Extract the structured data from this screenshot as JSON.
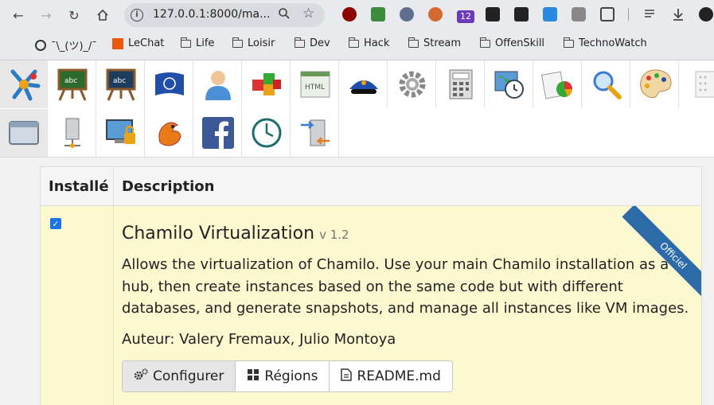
{
  "browser": {
    "url": "127.0.0.1:8000/ma...",
    "extension_badge": "12"
  },
  "bookmarks": [
    {
      "label": "¯\\_(ツ)_/¯",
      "icon": "openai-icon"
    },
    {
      "label": "LeChat",
      "icon": "lechat-icon"
    },
    {
      "label": "Life",
      "icon": "folder-icon"
    },
    {
      "label": "Loisir",
      "icon": "folder-icon"
    },
    {
      "label": "Dev",
      "icon": "folder-icon"
    },
    {
      "label": "Hack",
      "icon": "folder-icon"
    },
    {
      "label": "Stream",
      "icon": "folder-icon"
    },
    {
      "label": "OffenSkill",
      "icon": "folder-icon"
    },
    {
      "label": "TechnoWatch",
      "icon": "folder-icon"
    }
  ],
  "admin_icons": [
    "chamilo-logo-icon",
    "blackboard-easel-icon",
    "blackboard-easel-alt-icon",
    "un-flag-icon",
    "user-icon",
    "blocks-icon",
    "html-editor-icon",
    "police-cap-icon",
    "gear-icon",
    "calculator-icon",
    "world-clock-icon",
    "reports-icon",
    "magnifier-icon",
    "palette-icon",
    "dots-grid-icon",
    "window-icon",
    "server-icon",
    "monitor-lock-icon",
    "dragon-icon",
    "facebook-icon",
    "clock-icon",
    "server-transfer-icon"
  ],
  "table": {
    "col_installed": "Installé",
    "col_description": "Description"
  },
  "plugin": {
    "installed": true,
    "title": "Chamilo Virtualization",
    "version": "v 1.2",
    "description": "Allows the virtualization of Chamilo. Use your main Chamilo installation as a hub, then create instances based on the same code but with different databases, and generate snapshots, and manage all instances like VM images.",
    "author": "Auteur: Valery Fremaux, Julio Montoya",
    "ribbon": "Officiel",
    "buttons": {
      "configure": "Configurer",
      "regions": "Régions",
      "readme": "README.md"
    }
  }
}
